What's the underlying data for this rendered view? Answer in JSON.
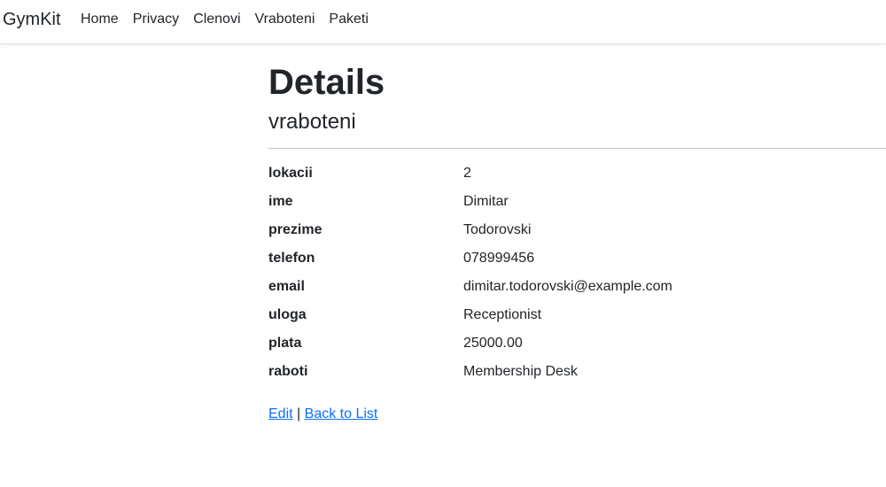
{
  "navbar": {
    "brand": "GymKit",
    "items": [
      {
        "label": "Home"
      },
      {
        "label": "Privacy"
      },
      {
        "label": "Clenovi"
      },
      {
        "label": "Vraboteni"
      },
      {
        "label": "Paketi"
      }
    ]
  },
  "page": {
    "title": "Details",
    "subtitle": "vraboteni"
  },
  "details": [
    {
      "label": "lokacii",
      "value": "2"
    },
    {
      "label": "ime",
      "value": "Dimitar"
    },
    {
      "label": "prezime",
      "value": "Todorovski"
    },
    {
      "label": "telefon",
      "value": "078999456"
    },
    {
      "label": "email",
      "value": "dimitar.todorovski@example.com"
    },
    {
      "label": "uloga",
      "value": "Receptionist"
    },
    {
      "label": "plata",
      "value": "25000.00"
    },
    {
      "label": "raboti",
      "value": "Membership Desk"
    }
  ],
  "actions": {
    "edit_label": "Edit",
    "separator": "|",
    "back_label": "Back to List"
  },
  "colors": {
    "link": "#0d6efd",
    "text": "#212529"
  }
}
